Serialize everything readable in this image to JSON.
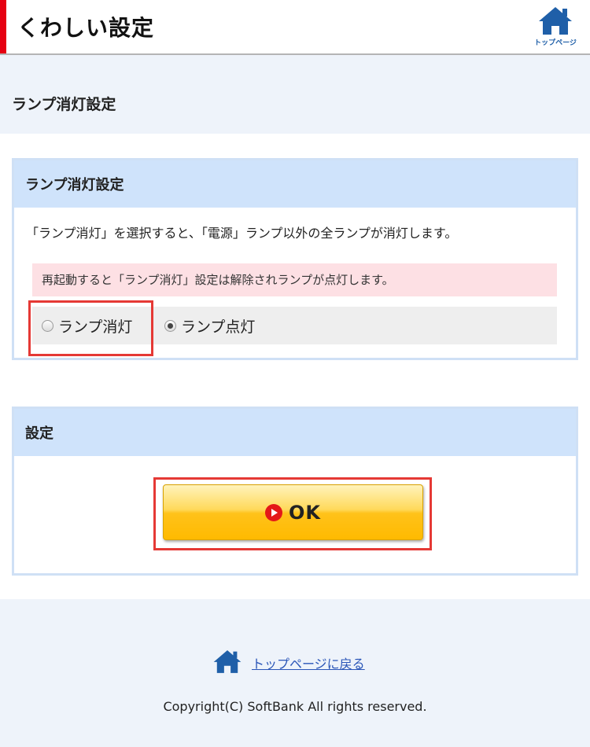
{
  "header": {
    "title": "くわしい設定",
    "home_label": "トップページ"
  },
  "page": {
    "subtitle": "ランプ消灯設定"
  },
  "lamp_panel": {
    "heading": "ランプ消灯設定",
    "description": "「ランプ消灯」を選択すると、「電源」ランプ以外の全ランプが消灯します。",
    "warning": "再起動すると「ランプ消灯」設定は解除されランプが点灯します。",
    "options": [
      {
        "label": "ランプ消灯",
        "checked": false
      },
      {
        "label": "ランプ点灯",
        "checked": true
      }
    ]
  },
  "settings_panel": {
    "heading": "設定",
    "ok_label": "OK"
  },
  "footer": {
    "back_link": "トップページに戻る",
    "copyright": "Copyright(C) SoftBank All rights reserved."
  },
  "colors": {
    "accent_red": "#e60012",
    "panel_header": "#cfe3fb",
    "warning_bg": "#fde0e4",
    "ok_button": "#ffc21a",
    "link": "#2a56b8"
  },
  "icons": {
    "home": "home-icon",
    "ok": "play-circle-icon"
  }
}
